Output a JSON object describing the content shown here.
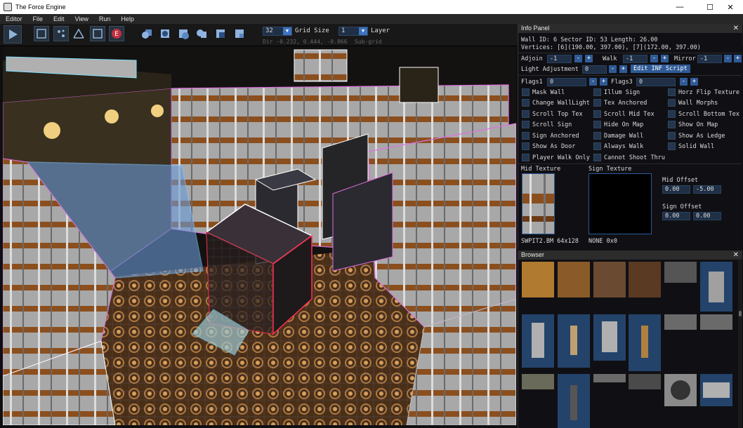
{
  "window": {
    "title": "The Force Engine",
    "minimize": "—",
    "maximize": "☐",
    "close": "✕"
  },
  "menu": [
    "Editor",
    "File",
    "Edit",
    "View",
    "Run",
    "Help"
  ],
  "toolbar": {
    "grid_size_value": "32",
    "grid_size_label": "Grid Size",
    "layer_value": "1",
    "layer_label": "Layer",
    "dir_readout": "Dir -0.232, 0.444, -0.866",
    "subgrid_label": "Sub-grid"
  },
  "info_panel": {
    "title": "Info Panel",
    "ids_line": "Wall ID: 6  Sector ID: 53  Length: 26.00",
    "vertices_line": "Vertices: [6](190.00, 397.00), [7](172.00, 397.00)",
    "adjoin_label": "Adjoin",
    "adjoin_value": "-1",
    "walk_label": "Walk",
    "walk_value": "-1",
    "mirror_label": "Mirror",
    "mirror_value": "-1",
    "light_label": "Light Adjustment",
    "light_value": "0",
    "edit_inf_label": "Edit INF Script",
    "flags1_label": "Flags1",
    "flags1_value": "0",
    "flags3_label": "Flags3",
    "flags3_value": "0",
    "flags_col1": [
      "Mask Wall",
      "Change WallLight",
      "Scroll Top Tex",
      "Scroll Sign",
      "Sign Anchored",
      "Show As Door",
      "Player Walk Only"
    ],
    "flags_col2": [
      "Illum Sign",
      "Tex Anchored",
      "Scroll Mid Tex",
      "Hide On Map",
      "Damage Wall",
      "Always Walk",
      "Cannot Shoot Thru"
    ],
    "flags_col3": [
      "Horz Flip Texture",
      "Wall Morphs",
      "Scroll Bottom Tex",
      "Show On Map",
      "Show As Ledge",
      "Solid Wall"
    ],
    "mid_texture_label": "Mid Texture",
    "sign_texture_label": "Sign Texture",
    "mid_texture_name": "SWPIT2.BM 64x128",
    "sign_texture_name": "NONE 0x0",
    "mid_offset_label": "Mid Offset",
    "mid_offset_x": "0.00",
    "mid_offset_y": "-5.00",
    "sign_offset_label": "Sign Offset",
    "sign_offset_x": "0.00",
    "sign_offset_y": "0.00"
  },
  "browser": {
    "title": "Browser"
  },
  "colors": {
    "accent": "#2f5a96",
    "field_bg": "#1f2f45",
    "wall_highlight": "#e070e0",
    "selection": "#ff3050"
  },
  "icons": [
    "play-icon",
    "select-icon",
    "vertex-icon",
    "wall-icon",
    "sector-icon",
    "entity-icon"
  ]
}
